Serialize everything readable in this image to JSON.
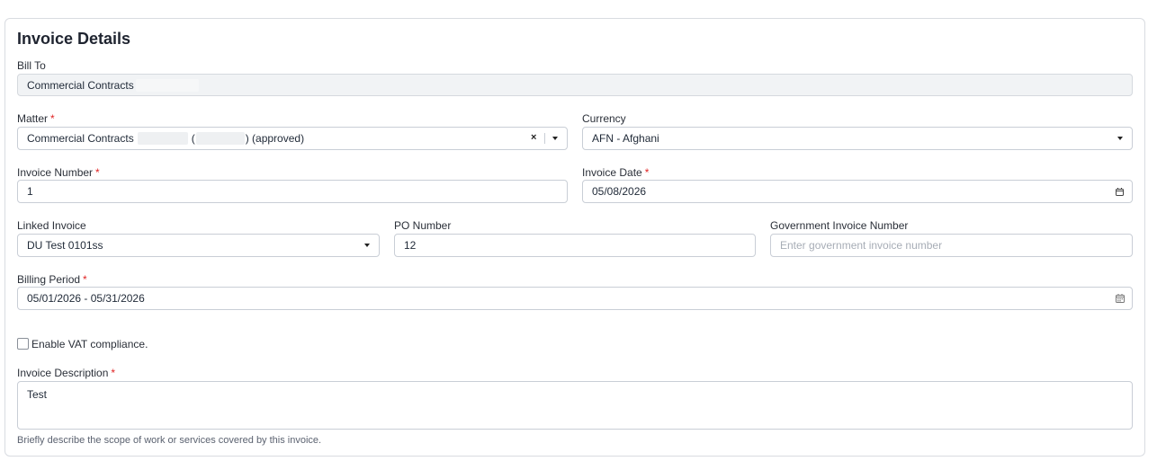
{
  "card": {
    "title": "Invoice Details",
    "bill_to": {
      "label": "Bill To",
      "value": "Commercial Contracts"
    },
    "matter": {
      "label": "Matter",
      "required_mark": "*",
      "value_prefix": "Commercial Contracts",
      "value_paren_open": "(",
      "value_suffix": ") (approved)"
    },
    "currency": {
      "label": "Currency",
      "value": "AFN - Afghani"
    },
    "invoice_number": {
      "label": "Invoice Number",
      "required_mark": "*",
      "value": "1"
    },
    "invoice_date": {
      "label": "Invoice Date",
      "required_mark": "*",
      "value": "05/08/2026"
    },
    "linked_invoice": {
      "label": "Linked Invoice",
      "value": "DU Test 0101ss"
    },
    "po_number": {
      "label": "PO Number",
      "value": "12"
    },
    "gov_invoice_number": {
      "label": "Government Invoice Number",
      "placeholder": "Enter government invoice number"
    },
    "billing_period": {
      "label": "Billing Period",
      "required_mark": "*",
      "value": "05/01/2026 - 05/31/2026"
    },
    "vat": {
      "label": "Enable VAT compliance.",
      "checked": false
    },
    "description": {
      "label": "Invoice Description",
      "required_mark": "*",
      "value": "Test",
      "help": "Briefly describe the scope of work or services covered by this invoice."
    }
  },
  "icons": {
    "dropdown": "caret-down-icon",
    "clear": "close-icon",
    "calendar": "calendar-icon"
  }
}
